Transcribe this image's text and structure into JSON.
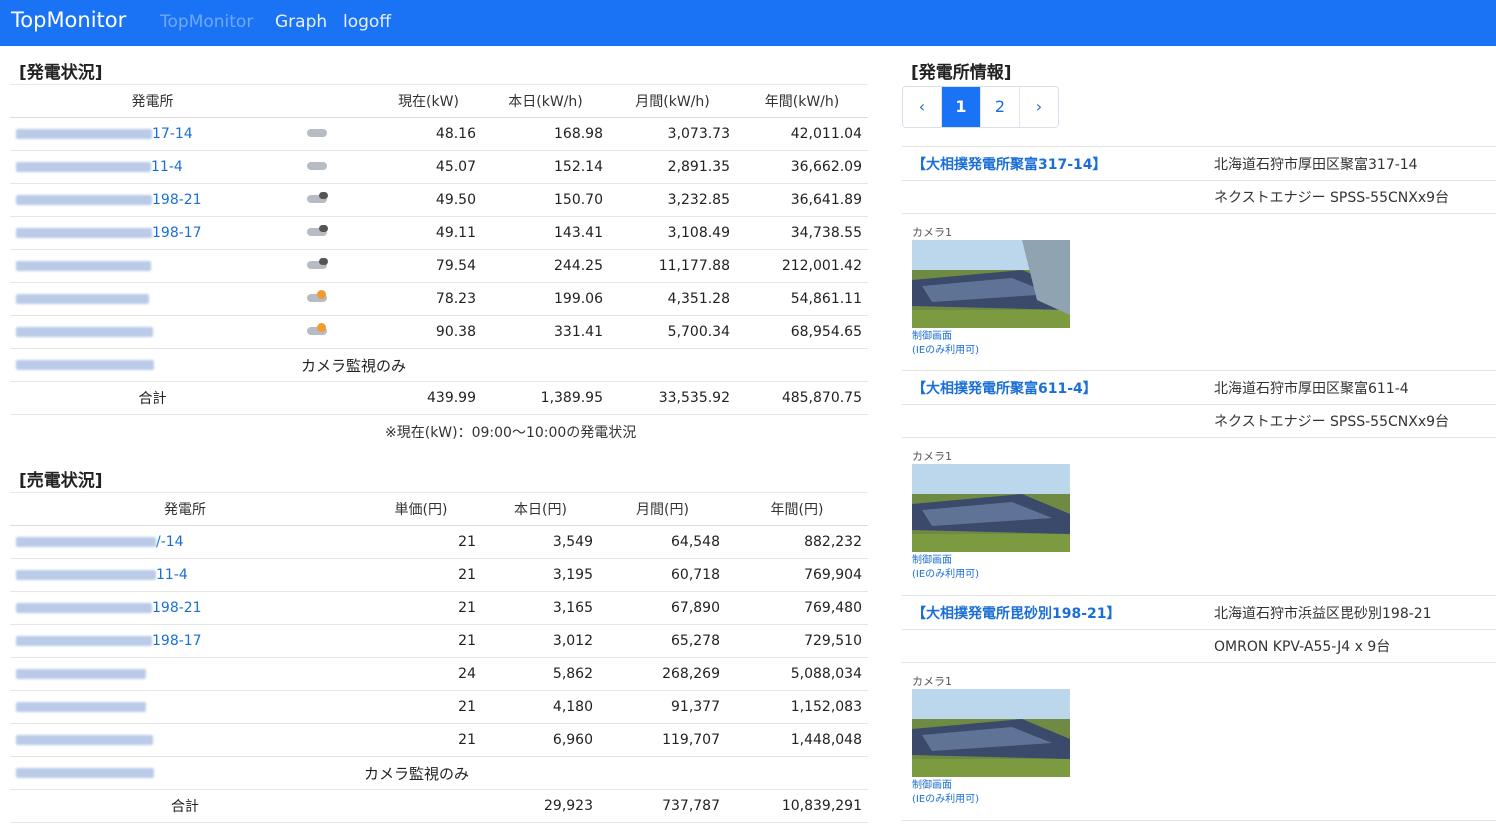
{
  "navbar": {
    "brand": "TopMonitor",
    "links": [
      "TopMonitor",
      "Graph",
      "logoff"
    ]
  },
  "generation": {
    "title": "[発電状況]",
    "headers": [
      "発電所",
      "",
      "現在(kW)",
      "本日(kW/h)",
      "月間(kW/h)",
      "年間(kW/h)"
    ],
    "rows": [
      {
        "name": "17-14",
        "weather": "cloud",
        "now": "48.16",
        "today": "168.98",
        "month": "3,073.73",
        "year": "42,011.04"
      },
      {
        "name": "11-4",
        "weather": "cloud",
        "now": "45.07",
        "today": "152.14",
        "month": "2,891.35",
        "year": "36,662.09"
      },
      {
        "name": "198-21",
        "weather": "rain",
        "now": "49.50",
        "today": "150.70",
        "month": "3,232.85",
        "year": "36,641.89"
      },
      {
        "name": "198-17",
        "weather": "rain",
        "now": "49.11",
        "today": "143.41",
        "month": "3,108.49",
        "year": "34,738.55"
      },
      {
        "name": "",
        "weather": "rain",
        "now": "79.54",
        "today": "244.25",
        "month": "11,177.88",
        "year": "212,001.42"
      },
      {
        "name": "",
        "weather": "sun",
        "now": "78.23",
        "today": "199.06",
        "month": "4,351.28",
        "year": "54,861.11"
      },
      {
        "name": "",
        "weather": "sun",
        "now": "90.38",
        "today": "331.41",
        "month": "5,700.34",
        "year": "68,954.65"
      }
    ],
    "camera_only": "カメラ監視のみ",
    "total_label": "合計",
    "totals": {
      "now": "439.99",
      "today": "1,389.95",
      "month": "33,535.92",
      "year": "485,870.75"
    },
    "note": "※現在(kW)：09:00～10:00の発電状況"
  },
  "sales": {
    "title": "[売電状況]",
    "headers": [
      "発電所",
      "単価(円)",
      "本日(円)",
      "月間(円)",
      "年間(円)"
    ],
    "rows": [
      {
        "name": "/-14",
        "price": "21",
        "today": "3,549",
        "month": "64,548",
        "year": "882,232"
      },
      {
        "name": "11-4",
        "price": "21",
        "today": "3,195",
        "month": "60,718",
        "year": "769,904"
      },
      {
        "name": "198-21",
        "price": "21",
        "today": "3,165",
        "month": "67,890",
        "year": "769,480"
      },
      {
        "name": "198-17",
        "price": "21",
        "today": "3,012",
        "month": "65,278",
        "year": "729,510"
      },
      {
        "name": "",
        "price": "24",
        "today": "5,862",
        "month": "268,269",
        "year": "5,088,034"
      },
      {
        "name": "",
        "price": "21",
        "today": "4,180",
        "month": "91,377",
        "year": "1,152,083"
      },
      {
        "name": "",
        "price": "21",
        "today": "6,960",
        "month": "119,707",
        "year": "1,448,048"
      }
    ],
    "camera_only": "カメラ監視のみ",
    "total_label": "合計",
    "totals": {
      "today": "29,923",
      "month": "737,787",
      "year": "10,839,291"
    }
  },
  "plant_info": {
    "title": "[発電所情報]",
    "pager": {
      "prev": "‹",
      "pages": [
        "1",
        "2"
      ],
      "next": "›"
    },
    "plants": [
      {
        "name": "【大相撲発電所聚富317-14】",
        "address": "北海道石狩市厚田区聚富317-14",
        "equipment": "ネクストエナジー SPSS-55CNXx9台",
        "camera": "カメラ1",
        "control": "制御画面",
        "ie_note": "(IEのみ利用可)"
      },
      {
        "name": "【大相撲発電所聚富611-4】",
        "address": "北海道石狩市厚田区聚富611-4",
        "equipment": "ネクストエナジー SPSS-55CNXx9台",
        "camera": "カメラ1",
        "control": "制御画面",
        "ie_note": "(IEのみ利用可)"
      },
      {
        "name": "【大相撲発電所毘砂別198-21】",
        "address": "北海道石狩市浜益区毘砂別198-21",
        "equipment": "OMRON KPV-A55-J4 x 9台",
        "camera": "カメラ1",
        "control": "制御画面",
        "ie_note": "(IEのみ利用可)"
      }
    ]
  }
}
